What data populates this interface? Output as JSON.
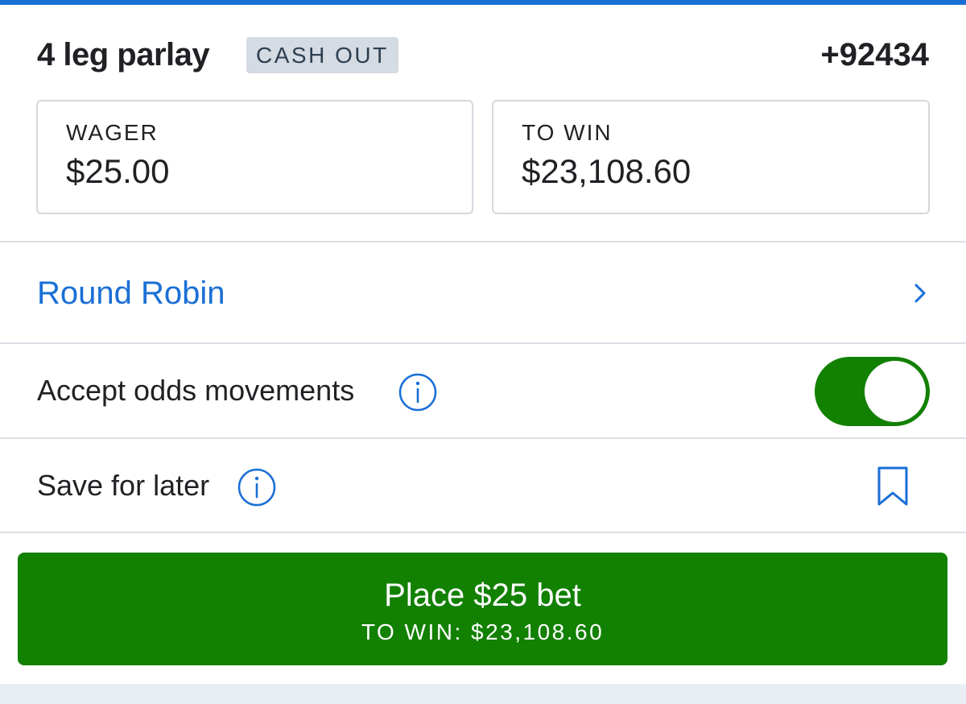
{
  "header": {
    "title": "4 leg parlay",
    "badge": "CASH OUT",
    "odds": "+92434"
  },
  "wager": {
    "label": "WAGER",
    "value": "$25.00"
  },
  "to_win": {
    "label": "TO WIN",
    "value": "$23,108.60"
  },
  "round_robin": {
    "label": "Round Robin",
    "icon": "chevron-right-icon"
  },
  "accept_odds": {
    "label": "Accept odds movements",
    "info_icon": "info-icon",
    "toggle_on": true
  },
  "save_for_later": {
    "label": "Save for later",
    "info_icon": "info-icon",
    "icon": "bookmark-icon"
  },
  "place_bet": {
    "label": "Place $25 bet",
    "sub_label": "TO WIN: $23,108.60"
  },
  "colors": {
    "accent_blue": "#1a6fd6",
    "action_green": "#128000",
    "badge_gray": "#d5dbe2",
    "divider": "#dadfe5"
  }
}
